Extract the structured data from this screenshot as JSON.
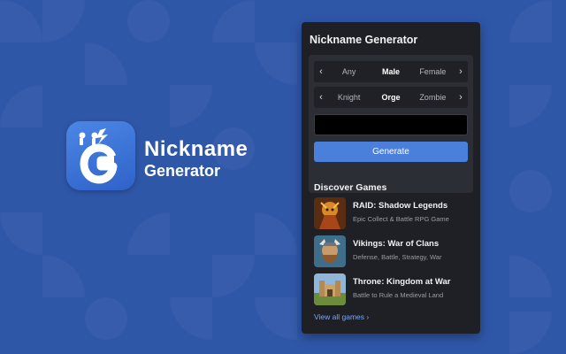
{
  "brand": {
    "title_line1": "Nickname",
    "title_line2": "Generator",
    "logo_letter": "G"
  },
  "panel": {
    "title": "Nickname Generator",
    "gender_selector": {
      "options": [
        "Any",
        "Male",
        "Female"
      ],
      "selected": "Male"
    },
    "style_selector": {
      "options": [
        "Knight",
        "Orge",
        "Zombie"
      ],
      "selected": "Orge"
    },
    "name_output": {
      "value": "",
      "placeholder": ""
    },
    "generate_label": "Generate",
    "discover_title": "Discover Games",
    "games": [
      {
        "name": "RAID: Shadow Legends",
        "description": "Epic Collect & Battle RPG Game",
        "icon": "raid-game-icon"
      },
      {
        "name": "Vikings: War of Clans",
        "description": "Defense, Battle, Strategy, War",
        "icon": "vikings-game-icon"
      },
      {
        "name": "Throne: Kingdom at War",
        "description": "Battle to Rule a Medieval Land",
        "icon": "throne-game-icon"
      }
    ],
    "view_all_label": "View all games",
    "view_all_chevron": "›"
  },
  "colors": {
    "background": "#2f57a8",
    "panel": "#1e2026",
    "accent": "#4a7fdc",
    "link": "#7ea4f0"
  }
}
